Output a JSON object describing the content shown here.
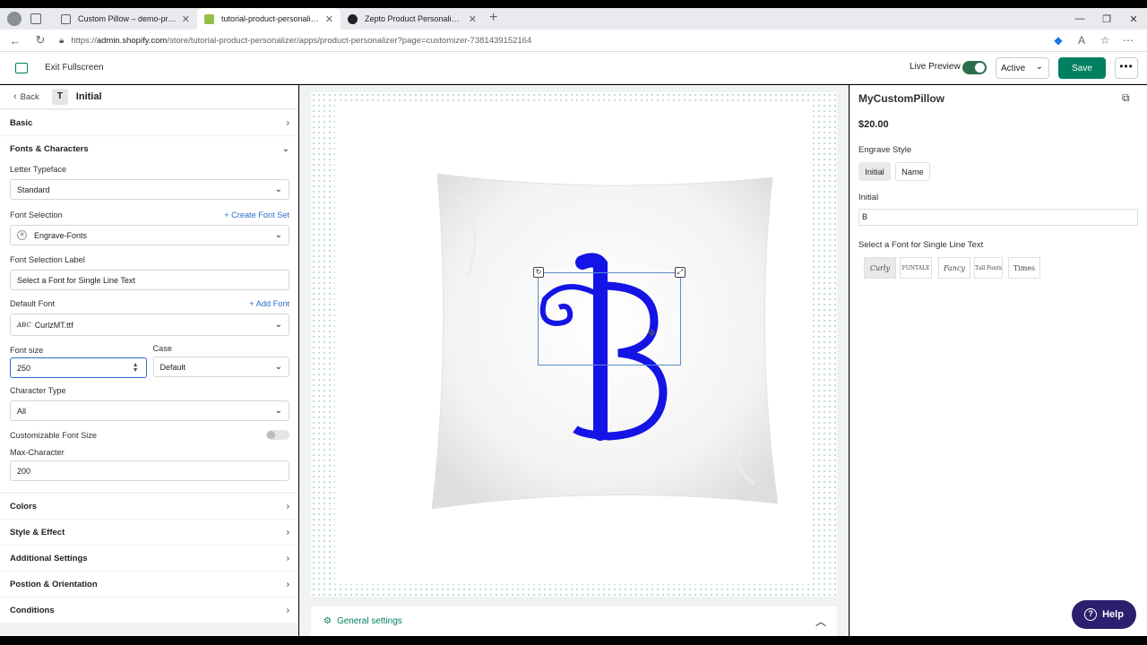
{
  "browser": {
    "tabs": [
      {
        "title": "Custom Pillow – demo-product-p",
        "active": false,
        "favicon_color": "#5f6368"
      },
      {
        "title": "tutorial-product-personalizer · Z",
        "active": true,
        "favicon_color": "#95bf47"
      },
      {
        "title": "Zepto Product Personalizer - Pro",
        "active": false,
        "favicon_color": "#202124"
      }
    ],
    "url_prefix": "https://",
    "url_host": "admin.shopify.com",
    "url_path": "/store/tutorial-product-personalizer/apps/product-personalizer?page=customizer-7381439152164"
  },
  "header": {
    "exit_label": "Exit Fullscreen",
    "live_preview_label": "Live Preview",
    "status_value": "Active",
    "save_label": "Save",
    "more_label": "•••"
  },
  "left": {
    "back_label": "Back",
    "badge": "T",
    "title": "Initial",
    "sections_top": [
      {
        "label": "Basic"
      }
    ],
    "fonts_section": "Fonts & Characters",
    "letter_typeface_label": "Letter Typeface",
    "letter_typeface_value": "Standard",
    "font_selection_label": "Font Selection",
    "create_font_set": "+ Create Font Set",
    "font_selection_value": "Engrave-Fonts",
    "font_selection_label_label": "Font Selection Label",
    "font_selection_label_value": "Select a Font for Single Line Text",
    "default_font_label": "Default Font",
    "add_font": "+ Add Font",
    "default_font_value": "CurlzMT.ttf",
    "default_font_prefix": "ABC",
    "font_size_label": "Font size",
    "font_size_value": "250",
    "case_label": "Case",
    "case_value": "Default",
    "character_type_label": "Character Type",
    "character_type_value": "All",
    "customizable_font_size_label": "Customizable Font Size",
    "max_character_label": "Max-Character",
    "max_character_value": "200",
    "sections_bottom": [
      {
        "label": "Colors"
      },
      {
        "label": "Style & Effect"
      },
      {
        "label": "Additional Settings"
      },
      {
        "label": "Postion & Orientation"
      },
      {
        "label": "Conditions"
      }
    ]
  },
  "canvas": {
    "letter": "B",
    "letter_color": "#1414e6",
    "general_settings": "General settings"
  },
  "preview": {
    "title": "MyCustomPillow",
    "price": "$20.00",
    "engrave_style_label": "Engrave Style",
    "engrave_options": [
      "Initial",
      "Name"
    ],
    "initial_label": "Initial",
    "initial_value": "B",
    "font_label": "Select a Font for Single Line Text",
    "font_swatches": [
      "Curly",
      "FUNTALE",
      "Fancy",
      "Tall Fonts",
      "Times"
    ],
    "help_label": "Help"
  },
  "colors": {
    "brand_green": "#008060",
    "link_blue": "#2c6ecb",
    "help_purple": "#2d1f6e"
  }
}
